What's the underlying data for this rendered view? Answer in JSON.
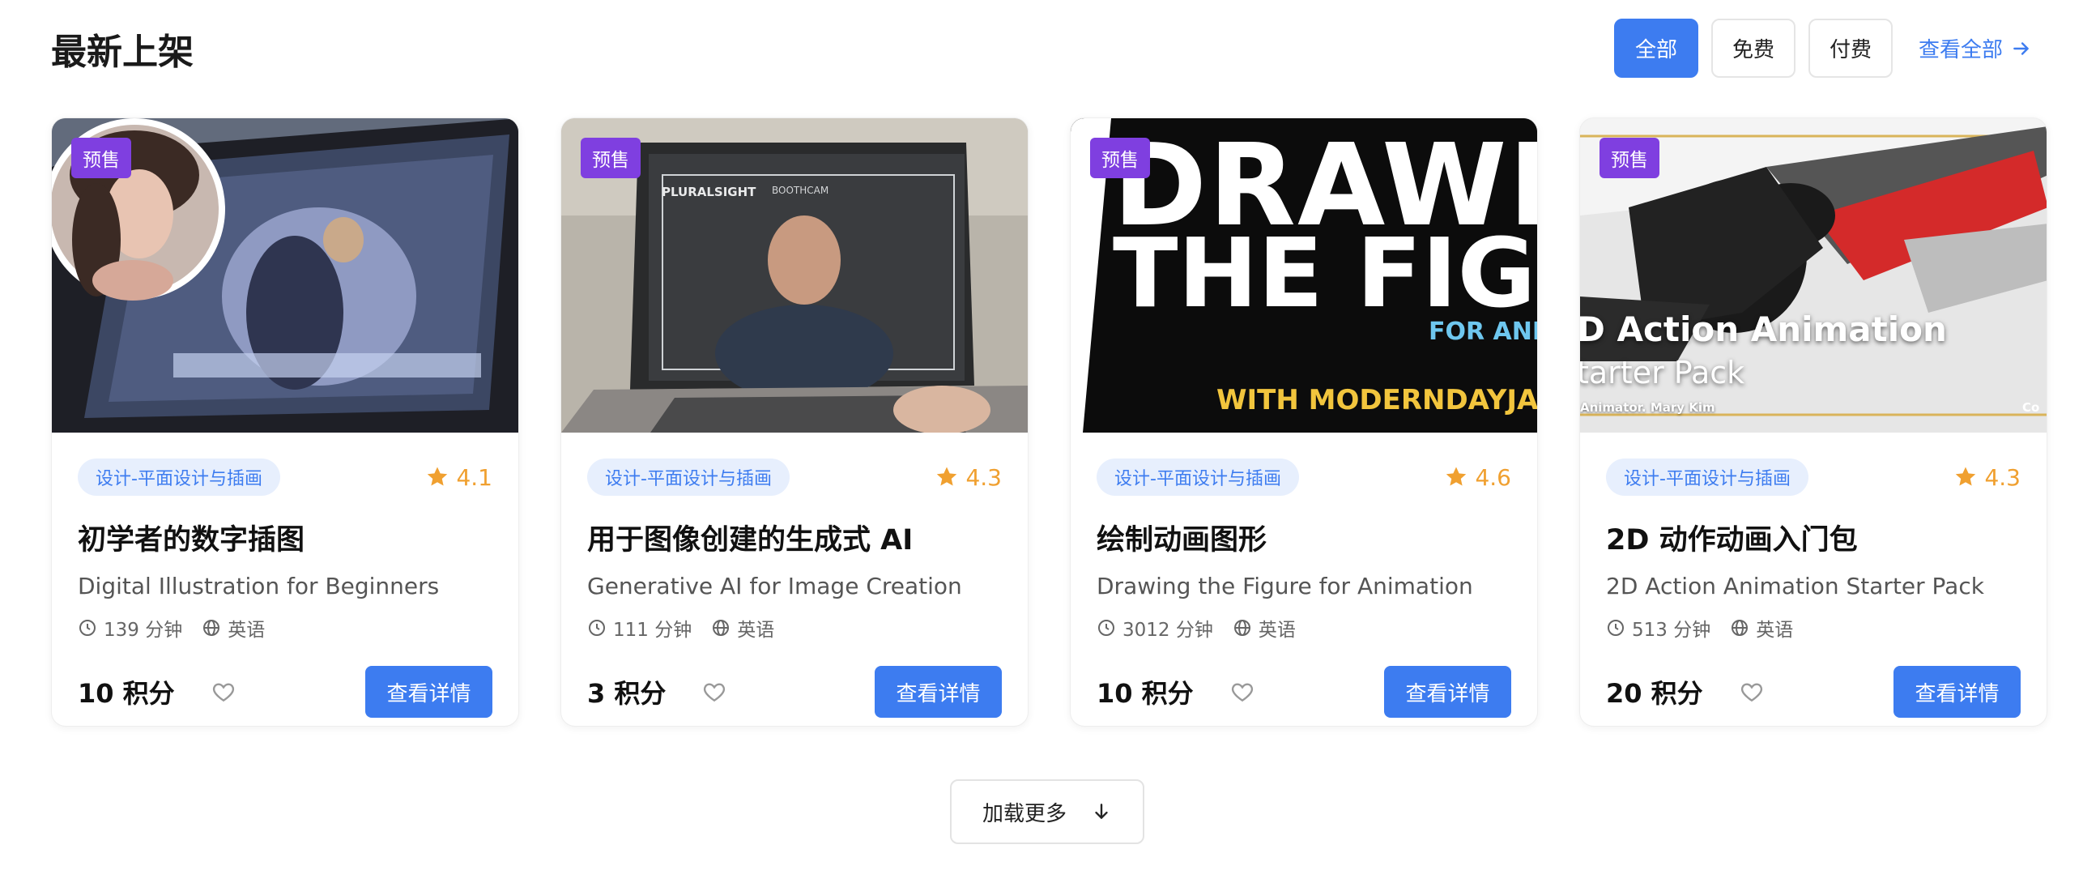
{
  "header": {
    "title": "最新上架",
    "filters": [
      {
        "label": "全部",
        "active": true
      },
      {
        "label": "免费",
        "active": false
      },
      {
        "label": "付费",
        "active": false
      }
    ],
    "view_all": "查看全部"
  },
  "cards": [
    {
      "badge": "预售",
      "thumb_texts": [],
      "category": "设计-平面设计与插画",
      "rating": "4.1",
      "title_cn": "初学者的数字插图",
      "title_en": "Digital Illustration for Beginners",
      "duration": "139 分钟",
      "language": "英语",
      "price": "10 积分",
      "detail_label": "查看详情"
    },
    {
      "badge": "预售",
      "thumb_texts": [
        "PLURALSIGHT",
        "BOOTHCAM"
      ],
      "category": "设计-平面设计与插画",
      "rating": "4.3",
      "title_cn": "用于图像创建的生成式 AI",
      "title_en": "Generative AI for Image Creation",
      "duration": "111 分钟",
      "language": "英语",
      "price": "3 积分",
      "detail_label": "查看详情"
    },
    {
      "badge": "预售",
      "thumb_texts": [
        "DRAWIN",
        "THE FIGU",
        "FOR ANI",
        "WITH MODERNDAYJAM"
      ],
      "category": "设计-平面设计与插画",
      "rating": "4.6",
      "title_cn": "绘制动画图形",
      "title_en": "Drawing the Figure for Animation",
      "duration": "3012 分钟",
      "language": "英语",
      "price": "10 积分",
      "detail_label": "查看详情"
    },
    {
      "badge": "预售",
      "thumb_texts": [
        "D Action Animation",
        "tarter Pack",
        "Animator. Mary Kim",
        "Co"
      ],
      "category": "设计-平面设计与插画",
      "rating": "4.3",
      "title_cn": "2D 动作动画入门包",
      "title_en": "2D Action Animation Starter Pack",
      "duration": "513 分钟",
      "language": "英语",
      "price": "20 积分",
      "detail_label": "查看详情"
    }
  ],
  "load_more": "加载更多",
  "colors": {
    "accent": "#3d7cf0",
    "presale": "#7f3fe0",
    "star": "#f0a030",
    "tag_bg": "#e7effd"
  },
  "icons": {
    "view_all": "arrow-right-icon",
    "rating": "star-icon",
    "duration": "clock-icon",
    "language": "globe-icon",
    "favorite": "heart-icon",
    "load_more": "arrow-down-icon"
  }
}
